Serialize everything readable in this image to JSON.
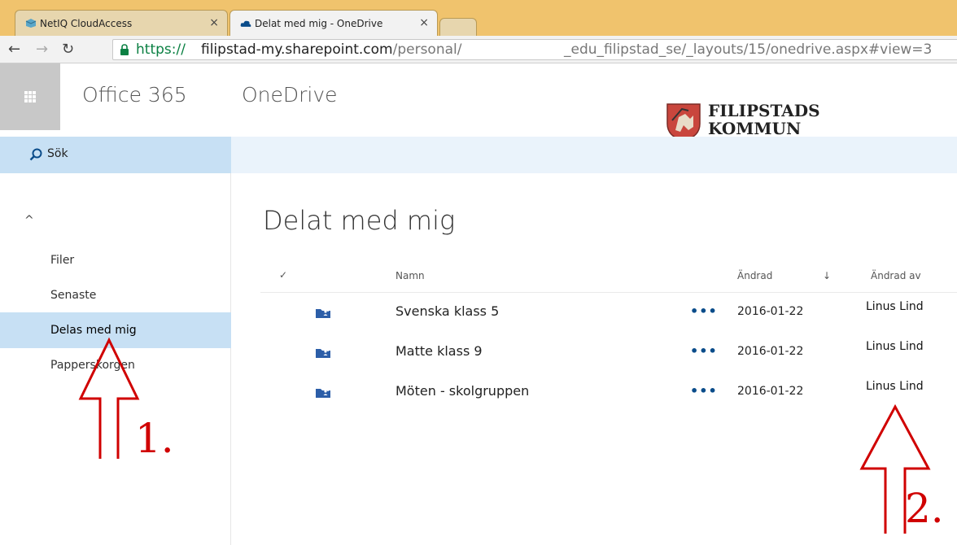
{
  "browser": {
    "tabs": [
      {
        "title": "NetIQ CloudAccess",
        "active": false
      },
      {
        "title": "Delat med mig - OneDrive",
        "active": true
      }
    ],
    "close_glyph": "×",
    "url": {
      "scheme": "https://",
      "host": "filipstad-my.sharepoint.com",
      "path_start": "/personal/",
      "path_end": "_edu_filipstad_se/_layouts/15/onedrive.aspx#view=3"
    }
  },
  "suite": {
    "suite_name": "Office 365",
    "app_name": "OneDrive",
    "logo_line1": "FILIPSTADS",
    "logo_line2": "KOMMUN"
  },
  "search": {
    "label": "Sök"
  },
  "nav": {
    "collapse_glyph": "^",
    "items": [
      {
        "label": "Filer",
        "selected": false
      },
      {
        "label": "Senaste",
        "selected": false
      },
      {
        "label": "Delas med mig",
        "selected": true
      },
      {
        "label": "Papperskorgen",
        "selected": false
      }
    ]
  },
  "main": {
    "title": "Delat med mig",
    "columns": {
      "check": "✓",
      "name": "Namn",
      "modified": "Ändrad",
      "sort_glyph": "↓",
      "modified_by": "Ändrad av"
    },
    "rows": [
      {
        "name": "Svenska klass 5",
        "more": "•••",
        "modified": "2016-01-22",
        "modified_by": "Linus Lind"
      },
      {
        "name": "Matte klass 9",
        "more": "•••",
        "modified": "2016-01-22",
        "modified_by": "Linus Lind"
      },
      {
        "name": "Möten - skolgruppen",
        "more": "•••",
        "modified": "2016-01-22",
        "modified_by": "Linus Lind"
      }
    ]
  },
  "annotations": {
    "first": "1.",
    "second": "2."
  },
  "colors": {
    "tabstrip": "#f0c36d",
    "selected": "#c7e0f4",
    "cmdbar": "#eaf3fb",
    "annotation": "#d00000",
    "ms_blue": "#0a4c8a"
  }
}
